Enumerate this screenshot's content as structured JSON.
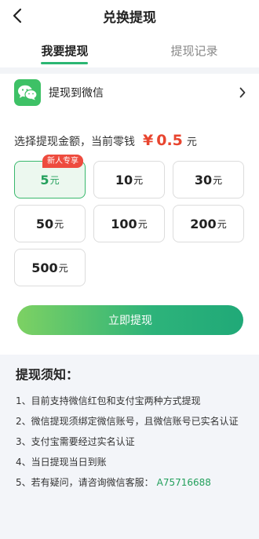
{
  "header": {
    "title": "兑换提现",
    "back_icon": "chevron-left-icon"
  },
  "tabs": [
    {
      "label": "我要提现",
      "active": true
    },
    {
      "label": "提现记录",
      "active": false
    }
  ],
  "channel": {
    "label": "提现到微信",
    "icon": "wechat-icon",
    "chevron": "chevron-right-icon"
  },
  "amount": {
    "prompt": "选择提现金额，当前零钱",
    "symbol": "¥",
    "balance": "0.5",
    "unit": "元"
  },
  "options": [
    {
      "value": "5",
      "unit": "元",
      "selected": true,
      "badge": "新人专享"
    },
    {
      "value": "10",
      "unit": "元"
    },
    {
      "value": "30",
      "unit": "元"
    },
    {
      "value": "50",
      "unit": "元"
    },
    {
      "value": "100",
      "unit": "元"
    },
    {
      "value": "200",
      "unit": "元"
    },
    {
      "value": "500",
      "unit": "元"
    }
  ],
  "cta": {
    "label": "立即提现"
  },
  "notes": {
    "title": "提现须知：",
    "items": [
      "1、目前支持微信红包和支付宝两种方式提现",
      "2、微信提现须绑定微信账号，且微信账号已实名认证",
      "3、支付宝需要经过实名认证",
      "4、当日提现当日到账",
      "5、若有疑问，请咨询微信客服："
    ],
    "wechat_id": "A75716688"
  },
  "colors": {
    "accent": "#2bb673",
    "price": "#e8452f",
    "badge": "#ee4b3e"
  }
}
